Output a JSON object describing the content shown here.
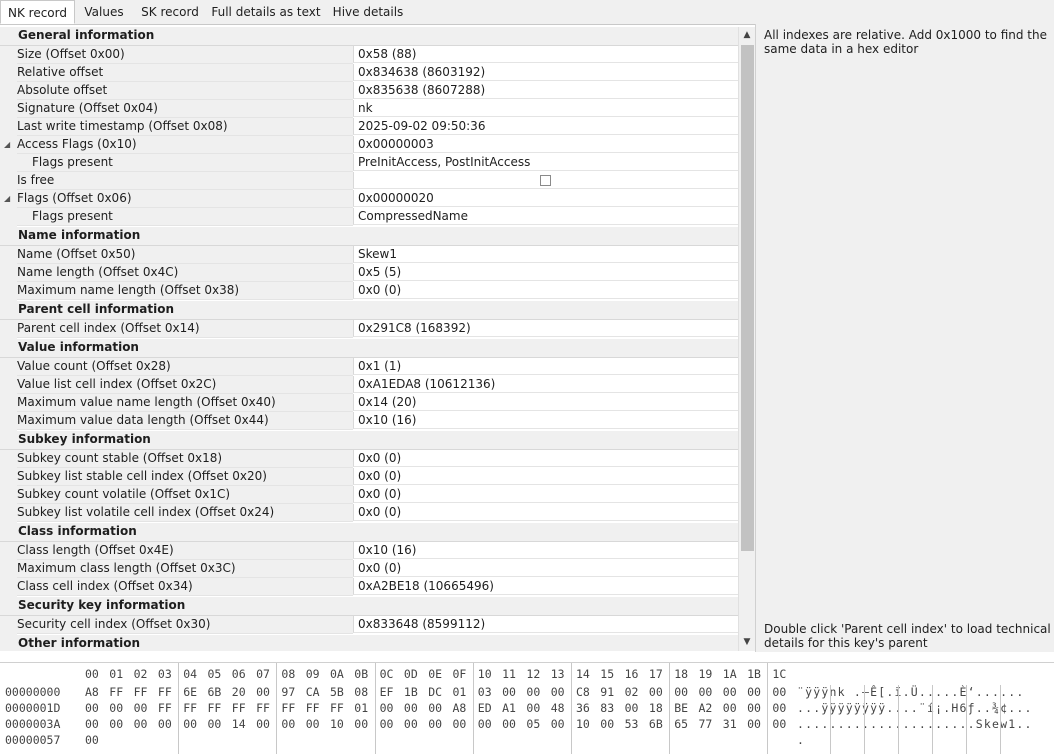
{
  "tabs": [
    {
      "label": "NK record",
      "active": true
    },
    {
      "label": "Values",
      "active": false
    },
    {
      "label": "SK record",
      "active": false
    },
    {
      "label": "Full details as text",
      "active": false
    },
    {
      "label": "Hive details",
      "active": false
    }
  ],
  "grid": {
    "categories": {
      "general": "General information",
      "name": "Name information",
      "parent": "Parent cell information",
      "value": "Value information",
      "subkey": "Subkey information",
      "class": "Class information",
      "security": "Security key information",
      "other": "Other information"
    },
    "props": {
      "size": {
        "label": "Size (Offset 0x00)",
        "value": "0x58 (88)"
      },
      "rel_offset": {
        "label": "Relative offset",
        "value": "0x834638 (8603192)"
      },
      "abs_offset": {
        "label": "Absolute offset",
        "value": "0x835638 (8607288)"
      },
      "signature": {
        "label": "Signature (Offset 0x04)",
        "value": "nk"
      },
      "last_write": {
        "label": "Last write timestamp (Offset 0x08)",
        "value": "2025-09-02 09:50:36"
      },
      "access_flags": {
        "label": "Access Flags (0x10)",
        "value": "0x00000003"
      },
      "access_flags_present": {
        "label": "Flags present",
        "value": "PreInitAccess, PostInitAccess"
      },
      "is_free": {
        "label": "Is free",
        "value": false
      },
      "flags": {
        "label": "Flags (Offset 0x06)",
        "value": "0x00000020"
      },
      "flags_present": {
        "label": "Flags present",
        "value": "CompressedName"
      },
      "name": {
        "label": "Name (Offset 0x50)",
        "value": "Skew1"
      },
      "name_length": {
        "label": "Name length (Offset 0x4C)",
        "value": "0x5 (5)"
      },
      "max_name_length": {
        "label": "Maximum name length (Offset 0x38)",
        "value": "0x0 (0)"
      },
      "parent_cell": {
        "label": "Parent cell index (Offset 0x14)",
        "value": "0x291C8 (168392)"
      },
      "value_count": {
        "label": "Value count (Offset 0x28)",
        "value": "0x1 (1)"
      },
      "value_list": {
        "label": "Value list cell index (Offset 0x2C)",
        "value": "0xA1EDA8 (10612136)"
      },
      "max_value_name": {
        "label": "Maximum value name length (Offset 0x40)",
        "value": "0x14 (20)"
      },
      "max_value_data": {
        "label": "Maximum value data length (Offset 0x44)",
        "value": "0x10 (16)"
      },
      "subkey_count_stable": {
        "label": "Subkey count stable (Offset 0x18)",
        "value": "0x0 (0)"
      },
      "subkey_list_stable": {
        "label": "Subkey list stable cell index (Offset 0x20)",
        "value": "0x0 (0)"
      },
      "subkey_count_volatile": {
        "label": "Subkey count volatile (Offset 0x1C)",
        "value": "0x0 (0)"
      },
      "subkey_list_volatile": {
        "label": "Subkey list volatile cell index (Offset 0x24)",
        "value": "0x0 (0)"
      },
      "class_length": {
        "label": "Class length (Offset 0x4E)",
        "value": "0x10 (16)"
      },
      "max_class_length": {
        "label": "Maximum class length (Offset 0x3C)",
        "value": "0x0 (0)"
      },
      "class_cell": {
        "label": "Class cell index (Offset 0x34)",
        "value": "0xA2BE18 (10665496)"
      },
      "security_cell": {
        "label": "Security cell index (Offset 0x30)",
        "value": "0x833648 (8599112)"
      }
    }
  },
  "right_panel": {
    "top_note": "All indexes are relative. Add 0x1000 to find the same data in a hex editor",
    "bottom_note": "Double click 'Parent cell index' to load technical details for this key's parent"
  },
  "hex": {
    "header": [
      "00",
      "01",
      "02",
      "03",
      "04",
      "05",
      "06",
      "07",
      "08",
      "09",
      "0A",
      "0B",
      "0C",
      "0D",
      "0E",
      "0F",
      "10",
      "11",
      "12",
      "13",
      "14",
      "15",
      "16",
      "17",
      "18",
      "19",
      "1A",
      "1B",
      "1C"
    ],
    "rows": [
      {
        "offset": "00000000",
        "bytes": [
          "A8",
          "FF",
          "FF",
          "FF",
          "6E",
          "6B",
          "20",
          "00",
          "97",
          "CA",
          "5B",
          "08",
          "EF",
          "1B",
          "DC",
          "01",
          "03",
          "00",
          "00",
          "00",
          "C8",
          "91",
          "02",
          "00",
          "00",
          "00",
          "00",
          "00",
          "00"
        ],
        "ascii": "¨ÿÿÿnk .—Ê[.ï.Ü.....È‘......"
      },
      {
        "offset": "0000001D",
        "bytes": [
          "00",
          "00",
          "00",
          "FF",
          "FF",
          "FF",
          "FF",
          "FF",
          "FF",
          "FF",
          "FF",
          "01",
          "00",
          "00",
          "00",
          "A8",
          "ED",
          "A1",
          "00",
          "48",
          "36",
          "83",
          "00",
          "18",
          "BE",
          "A2",
          "00",
          "00",
          "00"
        ],
        "ascii": "...ÿÿÿÿÿÿÿÿ....¨í¡.H6ƒ..¾¢..."
      },
      {
        "offset": "0000003A",
        "bytes": [
          "00",
          "00",
          "00",
          "00",
          "00",
          "00",
          "14",
          "00",
          "00",
          "00",
          "10",
          "00",
          "00",
          "00",
          "00",
          "00",
          "00",
          "00",
          "05",
          "00",
          "10",
          "00",
          "53",
          "6B",
          "65",
          "77",
          "31",
          "00",
          "00"
        ],
        "ascii": "......................Skew1.."
      },
      {
        "offset": "00000057",
        "bytes": [
          "00"
        ],
        "ascii": "."
      }
    ]
  }
}
